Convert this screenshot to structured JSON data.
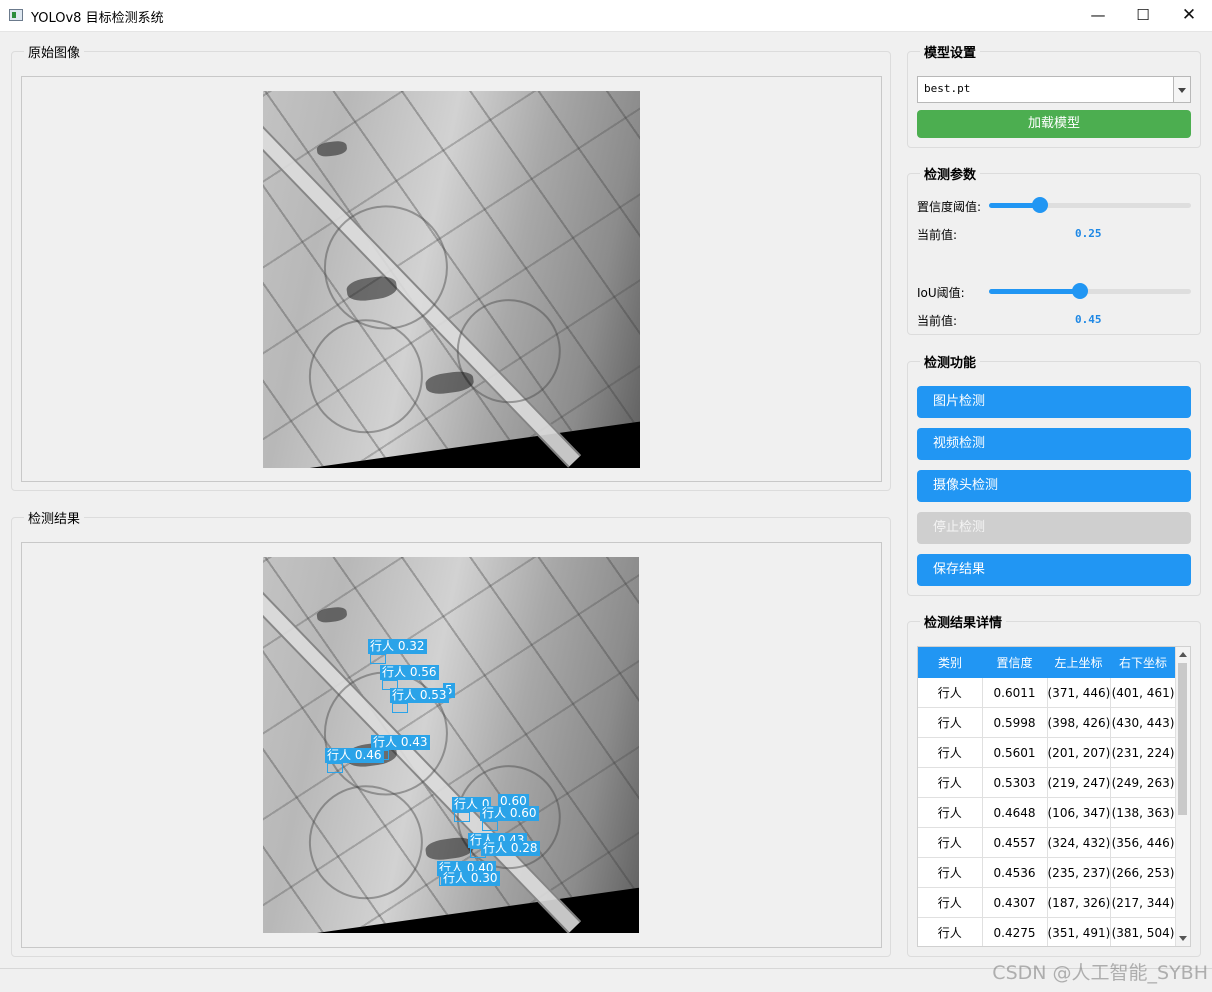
{
  "window": {
    "title": "YOLOv8 目标检测系统",
    "min_symbol": "—",
    "max_symbol": "☐",
    "close_symbol": "✕"
  },
  "original_panel": {
    "title": "原始图像"
  },
  "result_panel": {
    "title": "检测结果"
  },
  "detections": [
    {
      "label": "行人 0.32"
    },
    {
      "label": "行人 0.56"
    },
    {
      "label": "5"
    },
    {
      "label": "行人 0.53"
    },
    {
      "label": "行人 0.43"
    },
    {
      "label": "行人 0.46"
    },
    {
      "label": "行人 0"
    },
    {
      "label": "0.60"
    },
    {
      "label": "行人 0.60"
    },
    {
      "label": "行人 0.43"
    },
    {
      "label": "行人 0.28"
    },
    {
      "label": "行人 0.40"
    },
    {
      "label": "行人 0.30"
    }
  ],
  "model_settings": {
    "title": "模型设置",
    "model_file": "best.pt",
    "load_button": "加载模型"
  },
  "detection_params": {
    "title": "检测参数",
    "confidence": {
      "label": "置信度阈值:",
      "current_label": "当前值:",
      "value": "0.25",
      "fraction": 0.25
    },
    "iou": {
      "label": "IoU阈值:",
      "current_label": "当前值:",
      "value": "0.45",
      "fraction": 0.45
    }
  },
  "detection_functions": {
    "title": "检测功能",
    "image_button": "图片检测",
    "video_button": "视频检测",
    "camera_button": "摄像头检测",
    "stop_button": "停止检测",
    "save_button": "保存结果"
  },
  "results_detail": {
    "title": "检测结果详情",
    "columns": [
      "类别",
      "置信度",
      "左上坐标",
      "右下坐标"
    ],
    "rows": [
      [
        "行人",
        "0.6011",
        "(371, 446)",
        "(401, 461)"
      ],
      [
        "行人",
        "0.5998",
        "(398, 426)",
        "(430, 443)"
      ],
      [
        "行人",
        "0.5601",
        "(201, 207)",
        "(231, 224)"
      ],
      [
        "行人",
        "0.5303",
        "(219, 247)",
        "(249, 263)"
      ],
      [
        "行人",
        "0.4648",
        "(106, 347)",
        "(138, 363)"
      ],
      [
        "行人",
        "0.4557",
        "(324, 432)",
        "(356, 446)"
      ],
      [
        "行人",
        "0.4536",
        "(235, 237)",
        "(266, 253)"
      ],
      [
        "行人",
        "0.4307",
        "(187, 326)",
        "(217, 344)"
      ],
      [
        "行人",
        "0.4275",
        "(351, 491)",
        "(381, 504)"
      ]
    ]
  },
  "watermark": "CSDN @人工智能_SYBH",
  "colors": {
    "accent": "#2196f3",
    "load_button": "#4cae50",
    "disabled_button": "#cfcfcf",
    "detection_label": "#2ba3e8"
  }
}
